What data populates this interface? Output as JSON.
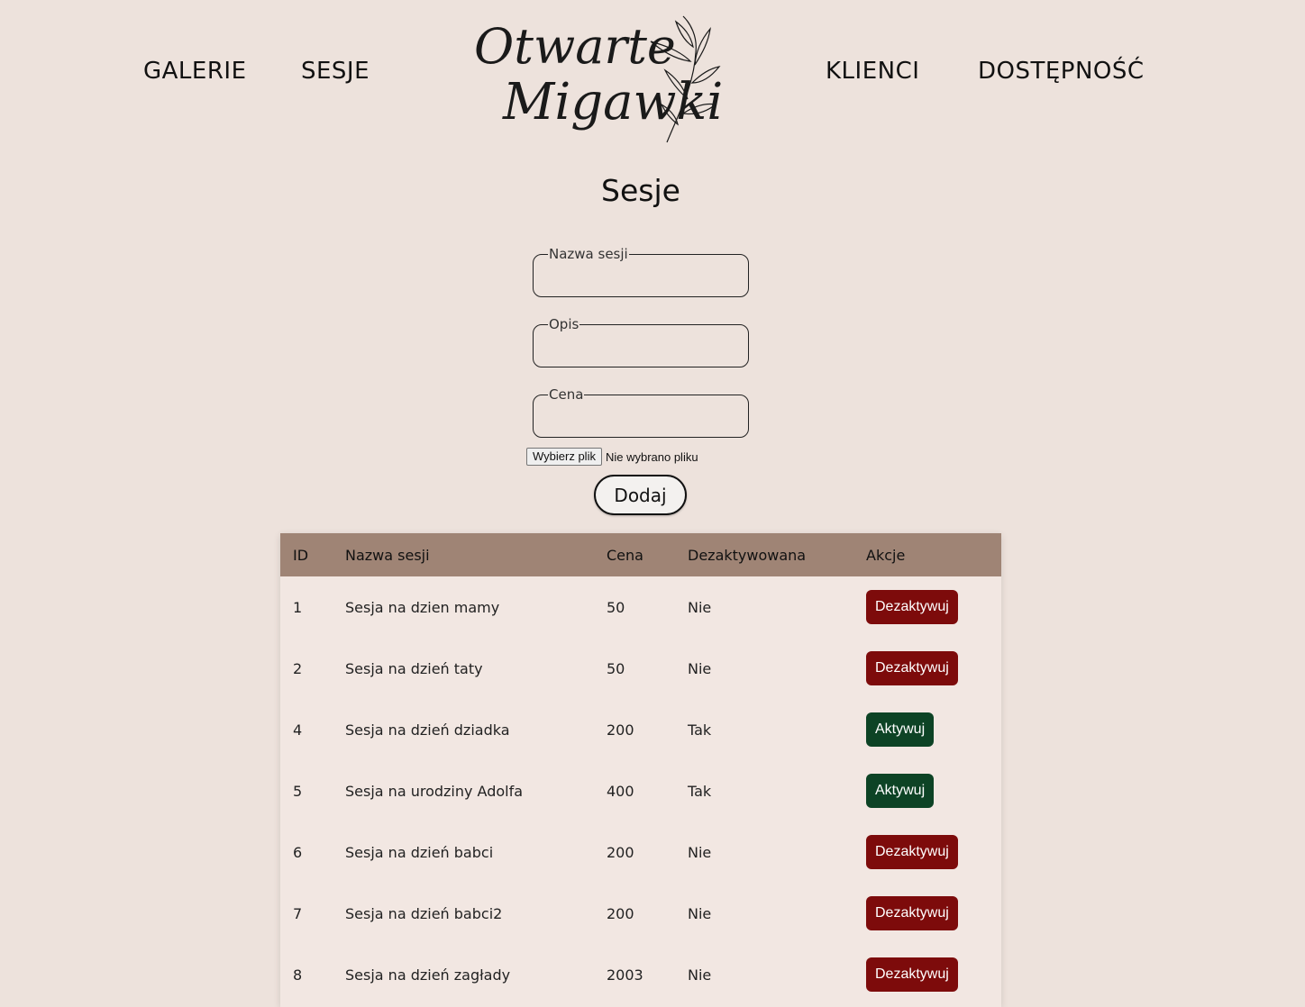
{
  "nav": {
    "left": [
      "GALERIE",
      "SESJE"
    ],
    "right": [
      "KLIENCI",
      "DOSTĘPNOŚĆ"
    ]
  },
  "logo": {
    "line1": "Otwarte",
    "line2": "Migawki"
  },
  "page": {
    "title": "Sesje"
  },
  "form": {
    "name_label": "Nazwa sesji",
    "name_value": "",
    "description_label": "Opis",
    "description_value": "",
    "price_label": "Cena",
    "price_value": "",
    "file_button": "Wybierz plik",
    "file_status": "Nie wybrano pliku",
    "submit_label": "Dodaj"
  },
  "table": {
    "headers": [
      "ID",
      "Nazwa sesji",
      "Cena",
      "Dezaktywowana",
      "Akcje"
    ],
    "rows": [
      {
        "id": "1",
        "name": "Sesja na dzien mamy",
        "price": "50",
        "deactivated": "Nie",
        "action": "Dezaktywuj"
      },
      {
        "id": "2",
        "name": "Sesja na dzień taty",
        "price": "50",
        "deactivated": "Nie",
        "action": "Dezaktywuj"
      },
      {
        "id": "4",
        "name": "Sesja na dzień dziadka",
        "price": "200",
        "deactivated": "Tak",
        "action": "Aktywuj"
      },
      {
        "id": "5",
        "name": "Sesja na urodziny Adolfa",
        "price": "400",
        "deactivated": "Tak",
        "action": "Aktywuj"
      },
      {
        "id": "6",
        "name": "Sesja na dzień babci",
        "price": "200",
        "deactivated": "Nie",
        "action": "Dezaktywuj"
      },
      {
        "id": "7",
        "name": "Sesja na dzień babci2",
        "price": "200",
        "deactivated": "Nie",
        "action": "Dezaktywuj"
      },
      {
        "id": "8",
        "name": "Sesja na dzień zagłady",
        "price": "2003",
        "deactivated": "Nie",
        "action": "Dezaktywuj"
      }
    ]
  },
  "colors": {
    "background": "#ede2dc",
    "table_header": "#9f8475",
    "deactivate": "#7d0b0b",
    "activate": "#0d4325"
  }
}
